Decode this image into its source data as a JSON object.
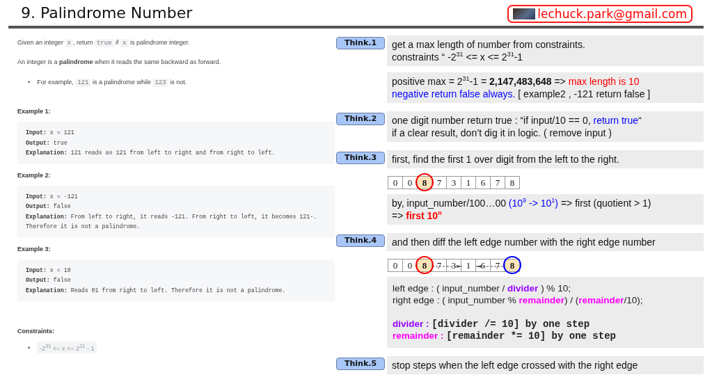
{
  "header": {
    "title": "9. Palindrome Number",
    "email": "lechuck.park@gmail.com"
  },
  "problem": {
    "paragraphs": [
      [
        {
          "kind": "text",
          "text": "Given an integer "
        },
        {
          "kind": "code",
          "text": "x"
        },
        {
          "kind": "text",
          "text": ", return "
        },
        {
          "kind": "code",
          "text": "true"
        },
        {
          "kind": "text",
          "text": " if "
        },
        {
          "kind": "code",
          "text": "x"
        },
        {
          "kind": "text",
          "text": " is palindrome integer."
        }
      ],
      [
        {
          "kind": "text",
          "text": "An integer is a **palindrome** when it reads the same backward as forward."
        }
      ]
    ],
    "bullets": [
      {
        "marker": "•",
        "segments": [
          {
            "kind": "text",
            "text": "For example, "
          },
          {
            "kind": "code",
            "text": "121"
          },
          {
            "kind": "text",
            "text": " is a palindrome while "
          },
          {
            "kind": "code",
            "text": "123"
          },
          {
            "kind": "text",
            "text": " is not."
          }
        ]
      }
    ],
    "examples": [
      {
        "title": "Example 1:",
        "lines": [
          {
            "label": "Input:",
            "text": "x = 121"
          },
          {
            "label": "Output:",
            "text": "true"
          },
          {
            "label": "Explanation:",
            "text": "121 reads as 121 from left to right and from right to left."
          }
        ]
      },
      {
        "title": "Example 2:",
        "lines": [
          {
            "label": "Input:",
            "text": "x = -121"
          },
          {
            "label": "Output:",
            "text": "false"
          },
          {
            "label": "Explanation:",
            "text": "From left to right, it reads -121. From right to left, it becomes 121-. Therefore it is not a palindrome."
          }
        ]
      },
      {
        "title": "Example 3:",
        "lines": [
          {
            "label": "Input:",
            "text": "x = 10"
          },
          {
            "label": "Output:",
            "text": "false"
          },
          {
            "label": "Explanation:",
            "text": "Reads 01 from right to left. Therefore it is not a palindrome."
          }
        ]
      }
    ],
    "constraints": {
      "title": "Constraints:",
      "items": [
        {
          "marker": "•",
          "text": "-2$^{31}$ <= x <= 2$^{31}$ - 1"
        }
      ]
    }
  },
  "steps": [
    {
      "label": "Think.1",
      "blocks": [
        {
          "kind": "note",
          "lines": [
            [
              {
                "text": "get a max length of number from constraints."
              }
            ],
            [
              {
                "text": "constraints “ -2$^{31}$ <= x <= 2$^{31}$-1"
              }
            ]
          ]
        },
        {
          "kind": "note",
          "lines": [
            [
              {
                "text": "positive max = 2$^{31}$-1 = **2,147,483,648** => "
              },
              {
                "text": "max length is 10",
                "color": "#ff0000"
              }
            ],
            [
              {
                "text": "negative return false always.",
                "color": "#0000ff"
              },
              {
                "text": " [ example2 , -121 return false ]"
              }
            ]
          ]
        }
      ]
    },
    {
      "label": "Think.2",
      "blocks": [
        {
          "kind": "note",
          "lines": [
            [
              {
                "text": "one digit number return true : “if input/10 == 0, "
              },
              {
                "text": "return true",
                "color": "#0000ff"
              },
              {
                "text": "“"
              }
            ],
            [
              {
                "text": "if a clear result, don’t dig it in logic. ( remove input )"
              }
            ]
          ]
        }
      ]
    },
    {
      "label": "Think.3",
      "blocks": [
        {
          "kind": "note",
          "lines": [
            [
              {
                "text": "first, find the first 1 over digit from the left to the right."
              }
            ]
          ]
        },
        {
          "kind": "digits",
          "cells": [
            {
              "digit": "0",
              "highlighted": false
            },
            {
              "digit": "0",
              "highlighted": false
            },
            {
              "digit": "8",
              "highlighted": true,
              "color": "#ff0000"
            },
            {
              "digit": "7",
              "highlighted": false
            },
            {
              "digit": "3",
              "highlighted": false
            },
            {
              "digit": "1",
              "highlighted": false
            },
            {
              "digit": "6",
              "highlighted": false
            },
            {
              "digit": "7",
              "highlighted": false
            },
            {
              "digit": "8",
              "highlighted": false
            }
          ]
        },
        {
          "kind": "note",
          "lines": [
            [
              {
                "text": "by, input_number/100…00 "
              },
              {
                "text": "(10$^{9}$ -> 10$^{1}$)",
                "color": "#0000ff"
              },
              {
                "text": " => first (quotient > 1)"
              }
            ],
            [
              {
                "text": " => "
              },
              {
                "text": "**first 10$^{n}$**",
                "color": "#ff0000"
              }
            ]
          ]
        }
      ]
    },
    {
      "label": "Think.4",
      "blocks": [
        {
          "kind": "note",
          "lines": [
            [
              {
                "text": "and then diff the left edge number with the right edge number"
              }
            ]
          ]
        },
        {
          "kind": "digits",
          "cells": [
            {
              "digit": "0",
              "highlighted": false
            },
            {
              "digit": "0",
              "highlighted": false
            },
            {
              "digit": "8",
              "highlighted": true,
              "color": "#ff0000"
            },
            {
              "digit": "7",
              "highlighted": false,
              "kind": "dashed"
            },
            {
              "digit": "3",
              "highlighted": false,
              "kind": "rightarrow"
            },
            {
              "digit": "1",
              "highlighted": false
            },
            {
              "digit": "6",
              "highlighted": false,
              "kind": "leftarrow"
            },
            {
              "digit": "7",
              "highlighted": false,
              "kind": "dashed"
            },
            {
              "digit": "8",
              "highlighted": true,
              "color": "#0000ff"
            }
          ]
        },
        {
          "kind": "code",
          "groups": [
            [
              [
                {
                  "text": "left edge : ( input_number / "
                },
                {
                  "text": "**divider**",
                  "color": "#9900ff"
                },
                {
                  "text": " ) % 10;"
                }
              ],
              [
                {
                  "text": "right edge : ( input_number  % "
                },
                {
                  "text": "**remainder**",
                  "color": "#ff00ff"
                },
                {
                  "text": ") / ("
                },
                {
                  "text": "**remainder**",
                  "color": "#ff00ff"
                },
                {
                  "text": "/10);"
                }
              ]
            ],
            [
              [
                {
                  "text": "**divider :** ",
                  "color": "#9900ff"
                },
                {
                  "text": "[divider /= 10] by one step",
                  "kind": "mono"
                }
              ],
              [
                {
                  "text": "**remainder :** ",
                  "color": "#ff00ff"
                },
                {
                  "text": "[remainder *= 10] by one step",
                  "kind": "mono"
                }
              ]
            ]
          ]
        }
      ]
    },
    {
      "label": "Think.5",
      "blocks": [
        {
          "kind": "note",
          "lines": [
            [
              {
                "text": "stop steps when the left edge crossed with the right edge"
              }
            ]
          ]
        }
      ]
    }
  ]
}
